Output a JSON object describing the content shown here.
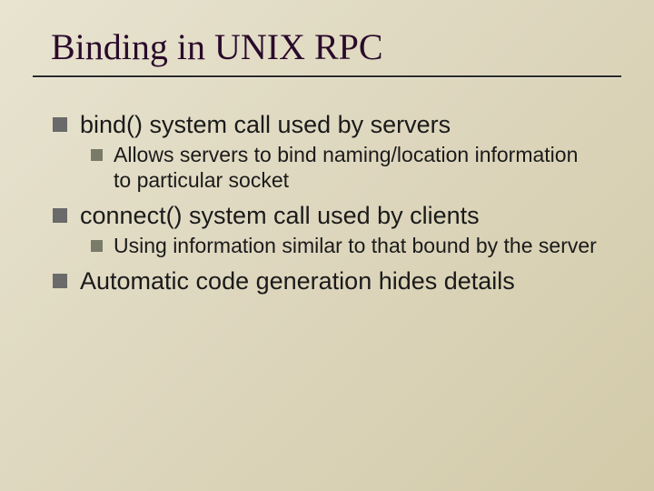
{
  "title": "Binding in UNIX RPC",
  "items": [
    {
      "text": "bind() system call used by servers",
      "sub": [
        "Allows servers to bind naming/location information to particular socket"
      ]
    },
    {
      "text": "connect() system call used by clients",
      "sub": [
        "Using information similar to that bound by the server"
      ]
    },
    {
      "text": "Automatic code generation hides details",
      "sub": []
    }
  ]
}
